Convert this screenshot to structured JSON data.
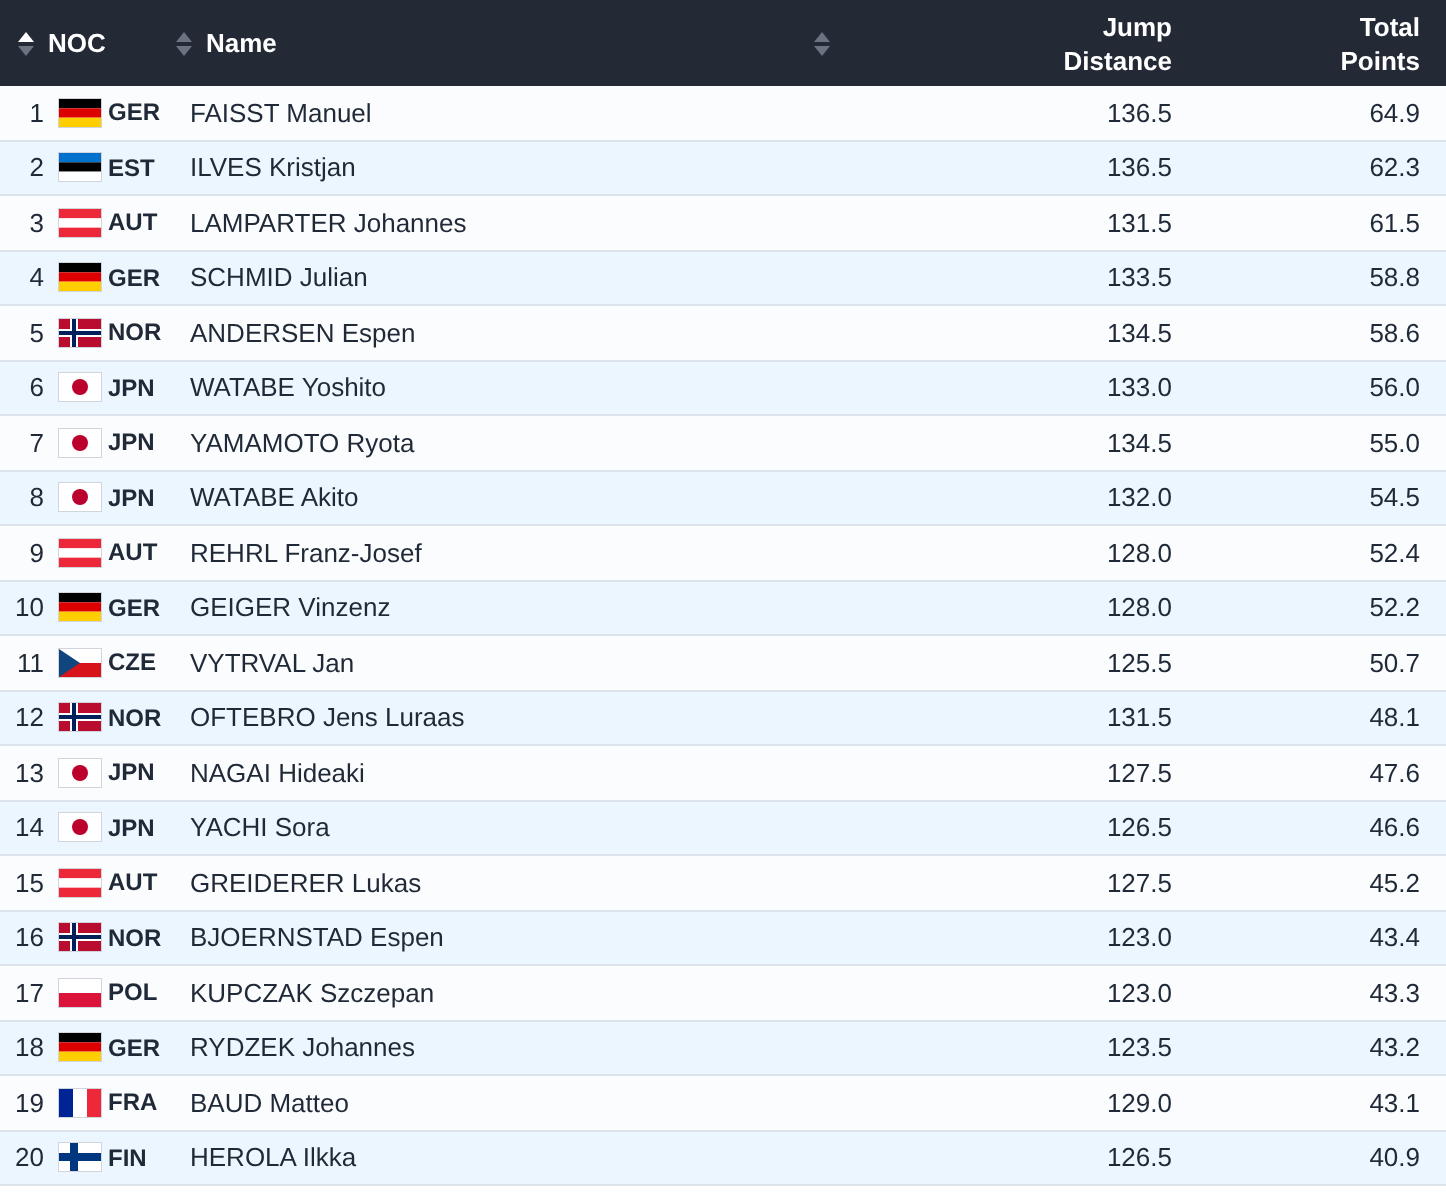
{
  "header": {
    "columns": [
      {
        "label": "NOC",
        "sorted": true
      },
      {
        "label": "Name",
        "sorted": false
      },
      {
        "sorted": false
      }
    ],
    "jump": [
      "Jump",
      "Distance"
    ],
    "points": [
      "Total",
      "Points"
    ]
  },
  "rows": [
    {
      "rank": "1",
      "kind": "de",
      "noc": "GER",
      "name": "FAISST Manuel",
      "jump": "136.5",
      "points": "64.9"
    },
    {
      "rank": "2",
      "kind": "ee",
      "noc": "EST",
      "name": "ILVES Kristjan",
      "jump": "136.5",
      "points": "62.3"
    },
    {
      "rank": "3",
      "kind": "at",
      "noc": "AUT",
      "name": "LAMPARTER Johannes",
      "jump": "131.5",
      "points": "61.5"
    },
    {
      "rank": "4",
      "kind": "de",
      "noc": "GER",
      "name": "SCHMID Julian",
      "jump": "133.5",
      "points": "58.8"
    },
    {
      "rank": "5",
      "kind": "no",
      "noc": "NOR",
      "name": "ANDERSEN Espen",
      "jump": "134.5",
      "points": "58.6"
    },
    {
      "rank": "6",
      "kind": "jp",
      "noc": "JPN",
      "name": "WATABE Yoshito",
      "jump": "133.0",
      "points": "56.0"
    },
    {
      "rank": "7",
      "kind": "jp",
      "noc": "JPN",
      "name": "YAMAMOTO Ryota",
      "jump": "134.5",
      "points": "55.0"
    },
    {
      "rank": "8",
      "kind": "jp",
      "noc": "JPN",
      "name": "WATABE Akito",
      "jump": "132.0",
      "points": "54.5"
    },
    {
      "rank": "9",
      "kind": "at",
      "noc": "AUT",
      "name": "REHRL Franz-Josef",
      "jump": "128.0",
      "points": "52.4"
    },
    {
      "rank": "10",
      "kind": "de",
      "noc": "GER",
      "name": "GEIGER Vinzenz",
      "jump": "128.0",
      "points": "52.2"
    },
    {
      "rank": "11",
      "kind": "cz",
      "noc": "CZE",
      "name": "VYTRVAL Jan",
      "jump": "125.5",
      "points": "50.7"
    },
    {
      "rank": "12",
      "kind": "no",
      "noc": "NOR",
      "name": "OFTEBRO Jens Luraas",
      "jump": "131.5",
      "points": "48.1"
    },
    {
      "rank": "13",
      "kind": "jp",
      "noc": "JPN",
      "name": "NAGAI Hideaki",
      "jump": "127.5",
      "points": "47.6"
    },
    {
      "rank": "14",
      "kind": "jp",
      "noc": "JPN",
      "name": "YACHI Sora",
      "jump": "126.5",
      "points": "46.6"
    },
    {
      "rank": "15",
      "kind": "at",
      "noc": "AUT",
      "name": "GREIDERER Lukas",
      "jump": "127.5",
      "points": "45.2"
    },
    {
      "rank": "16",
      "kind": "no",
      "noc": "NOR",
      "name": "BJOERNSTAD Espen",
      "jump": "123.0",
      "points": "43.4"
    },
    {
      "rank": "17",
      "kind": "pl",
      "noc": "POL",
      "name": "KUPCZAK Szczepan",
      "jump": "123.0",
      "points": "43.3"
    },
    {
      "rank": "18",
      "kind": "de",
      "noc": "GER",
      "name": "RYDZEK Johannes",
      "jump": "123.5",
      "points": "43.2"
    },
    {
      "rank": "19",
      "kind": "fr",
      "noc": "FRA",
      "name": "BAUD Matteo",
      "jump": "129.0",
      "points": "43.1"
    },
    {
      "rank": "20",
      "kind": "fi",
      "noc": "FIN",
      "name": "HEROLA Ilkka",
      "jump": "126.5",
      "points": "40.9"
    }
  ]
}
